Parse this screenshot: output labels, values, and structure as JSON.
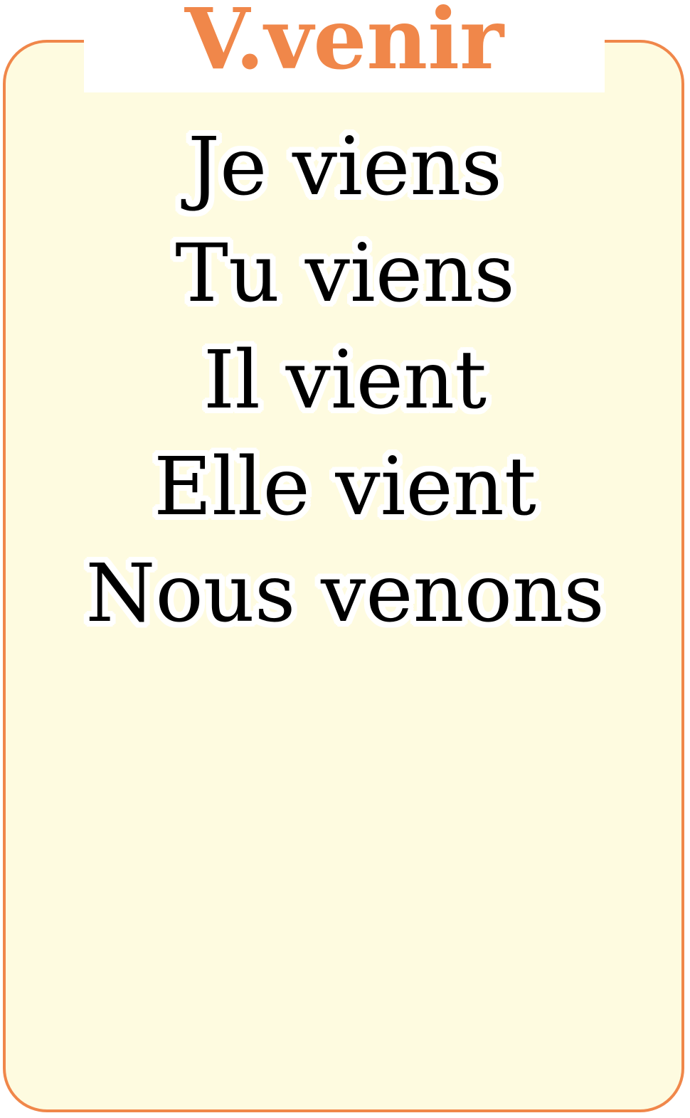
{
  "title": "V.venir",
  "conjugations": [
    "Je viens",
    "Tu viens",
    "Il vient",
    "Elle vient",
    "Nous venons"
  ],
  "colors": {
    "accent": "#f0874a",
    "card_background": "#fefbe0",
    "text": "#000000"
  }
}
